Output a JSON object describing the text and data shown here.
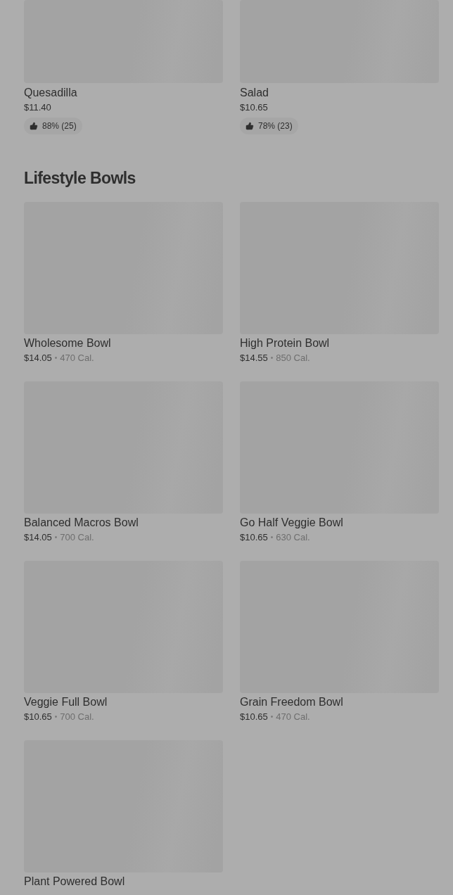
{
  "top_items": [
    {
      "name": "Quesadilla",
      "price": "$11.40",
      "rating": "88% (25)"
    },
    {
      "name": "Salad",
      "price": "$10.65",
      "rating": "78% (23)"
    }
  ],
  "section": {
    "title": "Lifestyle Bowls",
    "items": [
      {
        "name": "Wholesome Bowl",
        "price": "$14.05",
        "separator": "•",
        "calories": "470 Cal."
      },
      {
        "name": "High Protein Bowl",
        "price": "$14.55",
        "separator": "•",
        "calories": "850 Cal."
      },
      {
        "name": "Balanced Macros Bowl",
        "price": "$14.05",
        "separator": "•",
        "calories": "700 Cal."
      },
      {
        "name": "Go Half Veggie Bowl",
        "price": "$10.65",
        "separator": "•",
        "calories": "630 Cal."
      },
      {
        "name": "Veggie Full Bowl",
        "price": "$10.65",
        "separator": "•",
        "calories": "700 Cal."
      },
      {
        "name": "Grain Freedom Bowl",
        "price": "$10.65",
        "separator": "•",
        "calories": "470 Cal."
      },
      {
        "name": "Plant Powered Bowl"
      }
    ]
  }
}
